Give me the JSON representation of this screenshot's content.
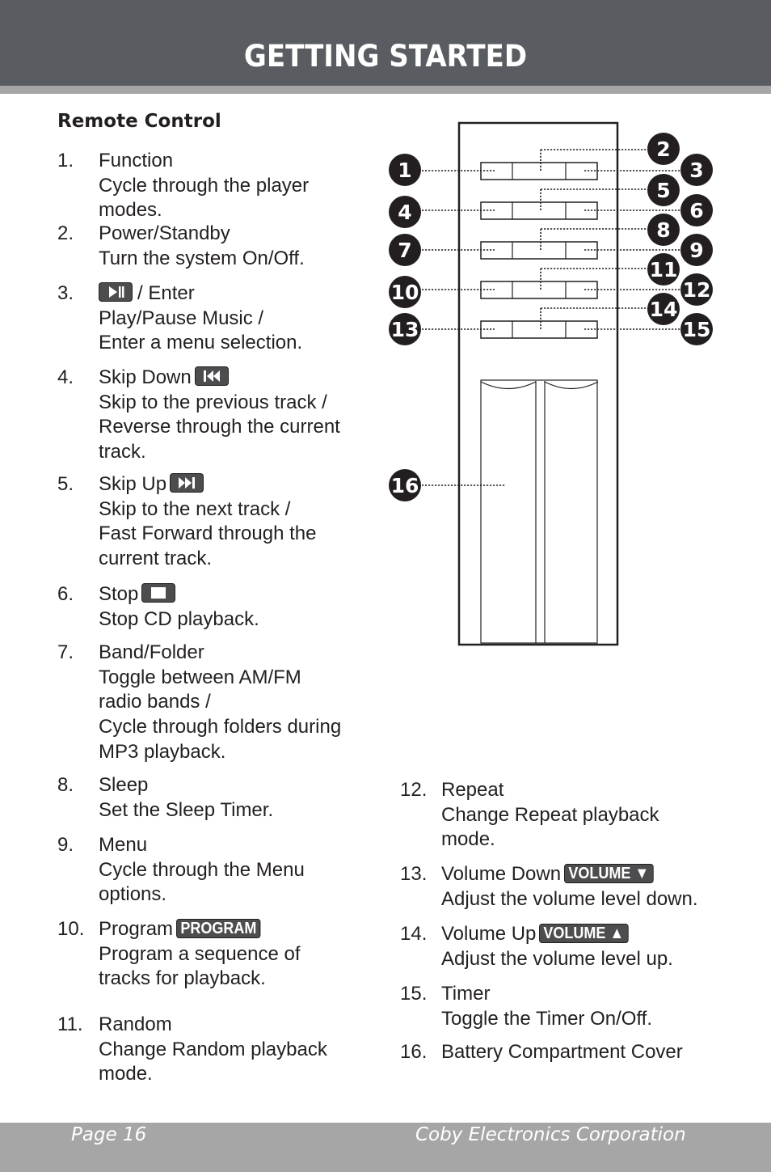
{
  "header": {
    "title": "GETTING STARTED"
  },
  "section": {
    "title": "Remote Control"
  },
  "items": [
    {
      "num": "1.",
      "title": "Function",
      "lines": [
        "Cycle through the player",
        "modes."
      ]
    },
    {
      "num": "2.",
      "title": "Power/Standby",
      "lines": [
        "Turn the system On/Off."
      ]
    },
    {
      "num": "3.",
      "title": "/ Enter",
      "icon": "play-pause-icon",
      "icon_position": "before",
      "lines": [
        "Play/Pause Music /",
        "Enter a menu selection."
      ]
    },
    {
      "num": "4.",
      "title": "Skip Down",
      "icon": "skip-back-icon",
      "icon_position": "after",
      "lines": [
        "Skip to the previous track /",
        "Reverse through the current",
        "track."
      ]
    },
    {
      "num": "5.",
      "title": "Skip Up",
      "icon": "skip-forward-icon",
      "icon_position": "after",
      "lines": [
        "Skip to the next track /",
        "Fast Forward through the",
        "current track."
      ]
    },
    {
      "num": "6.",
      "title": "Stop",
      "icon": "stop-icon",
      "icon_position": "after",
      "lines": [
        "Stop CD playback."
      ]
    },
    {
      "num": "7.",
      "title": "Band/Folder",
      "lines": [
        "Toggle between AM/FM",
        "radio bands /",
        "Cycle through folders during",
        "MP3 playback."
      ]
    },
    {
      "num": "8.",
      "title": "Sleep",
      "lines": [
        "Set the Sleep Timer."
      ]
    },
    {
      "num": "9.",
      "title": "Menu",
      "lines": [
        "Cycle through the Menu",
        "options."
      ]
    },
    {
      "num": "10.",
      "title": "Program",
      "badge": "PROGRAM",
      "lines": [
        "Program a sequence of",
        "tracks for playback."
      ]
    },
    {
      "num": "11.",
      "title": "Random",
      "lines": [
        "Change Random playback",
        "mode."
      ]
    },
    {
      "num": "12.",
      "title": "Repeat",
      "lines": [
        "Change Repeat playback",
        "mode."
      ]
    },
    {
      "num": "13.",
      "title": "Volume Down",
      "badge": "VOLUME ▼",
      "lines": [
        "Adjust the volume level down."
      ]
    },
    {
      "num": "14.",
      "title": "Volume Up",
      "badge": "VOLUME ▲",
      "lines": [
        "Adjust the volume level up."
      ]
    },
    {
      "num": "15.",
      "title": "Timer",
      "lines": [
        "Toggle the Timer On/Off."
      ]
    },
    {
      "num": "16.",
      "title": "Battery Compartment Cover",
      "lines": []
    }
  ],
  "diagram": {
    "callouts": [
      "1",
      "2",
      "3",
      "4",
      "5",
      "6",
      "7",
      "8",
      "9",
      "10",
      "11",
      "12",
      "13",
      "14",
      "15",
      "16"
    ]
  },
  "footer": {
    "page": "Page 16",
    "company": "Coby Electronics Corporation"
  }
}
